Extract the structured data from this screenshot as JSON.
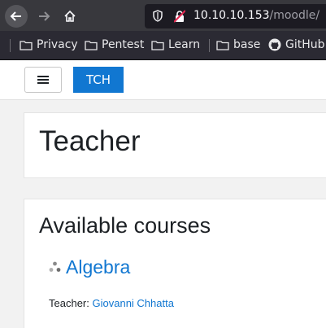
{
  "browser": {
    "url_host": "10.10.10.153",
    "url_path": "/moodle/",
    "bookmarks": [
      {
        "label": "Privacy",
        "icon": "folder-icon"
      },
      {
        "label": "Pentest",
        "icon": "folder-icon"
      },
      {
        "label": "Learn",
        "icon": "folder-icon"
      },
      {
        "label": "base",
        "icon": "folder-icon"
      },
      {
        "label": "GitHub",
        "icon": "github-icon"
      }
    ]
  },
  "navbar": {
    "user_button": "TCH"
  },
  "page_header": {
    "title": "Teacher"
  },
  "main": {
    "section_title": "Available courses",
    "course": {
      "name": "Algebra",
      "teacher_label": "Teacher:",
      "teacher_name": "Giovanni Chhatta"
    }
  },
  "colors": {
    "accent": "#1177d1",
    "chrome_dark": "#38383d"
  }
}
